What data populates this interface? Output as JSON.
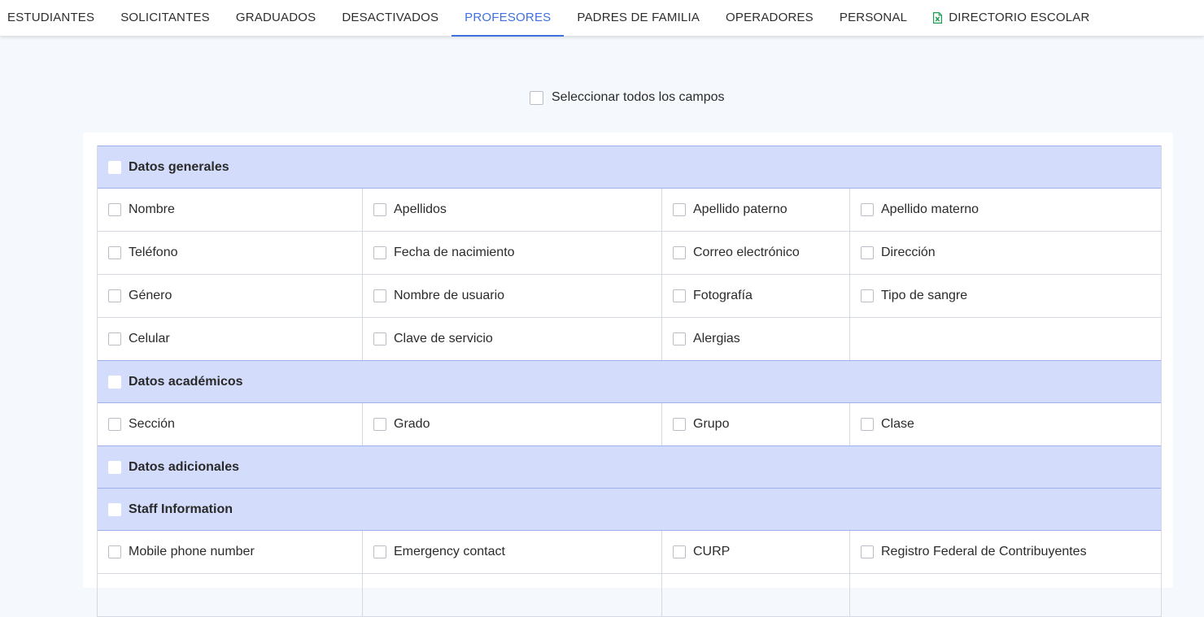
{
  "tabs": [
    {
      "label": "ESTUDIANTES",
      "active": false
    },
    {
      "label": "SOLICITANTES",
      "active": false
    },
    {
      "label": "GRADUADOS",
      "active": false
    },
    {
      "label": "DESACTIVADOS",
      "active": false
    },
    {
      "label": "PROFESORES",
      "active": true
    },
    {
      "label": "PADRES DE FAMILIA",
      "active": false
    },
    {
      "label": "OPERADORES",
      "active": false
    },
    {
      "label": "PERSONAL",
      "active": false
    },
    {
      "label": "DIRECTORIO ESCOLAR",
      "active": false,
      "icon": "excel-file-icon"
    }
  ],
  "colors": {
    "accent": "#3f6fe0",
    "section_bg": "#d3ddfb",
    "section_border": "#9fb1ee",
    "excel_green": "#1f9d55"
  },
  "select_all": {
    "label": "Seleccionar todos los campos",
    "checked": false
  },
  "sections": [
    {
      "title": "Datos generales",
      "rows": [
        [
          "Nombre",
          "Apellidos",
          "Apellido paterno",
          "Apellido materno"
        ],
        [
          "Teléfono",
          "Fecha de nacimiento",
          "Correo electrónico",
          "Dirección"
        ],
        [
          "Género",
          "Nombre de usuario",
          "Fotografía",
          "Tipo de sangre"
        ],
        [
          "Celular",
          "Clave de servicio",
          "Alergias",
          ""
        ]
      ]
    },
    {
      "title": "Datos académicos",
      "rows": [
        [
          "Sección",
          "Grado",
          "Grupo",
          "Clase"
        ]
      ]
    },
    {
      "title": "Datos adicionales",
      "rows": []
    },
    {
      "title": "Staff Information",
      "rows": [
        [
          "Mobile phone number",
          "Emergency contact",
          "CURP",
          "Registro Federal de Contribuyentes"
        ],
        [
          "",
          "",
          "",
          ""
        ]
      ]
    }
  ]
}
